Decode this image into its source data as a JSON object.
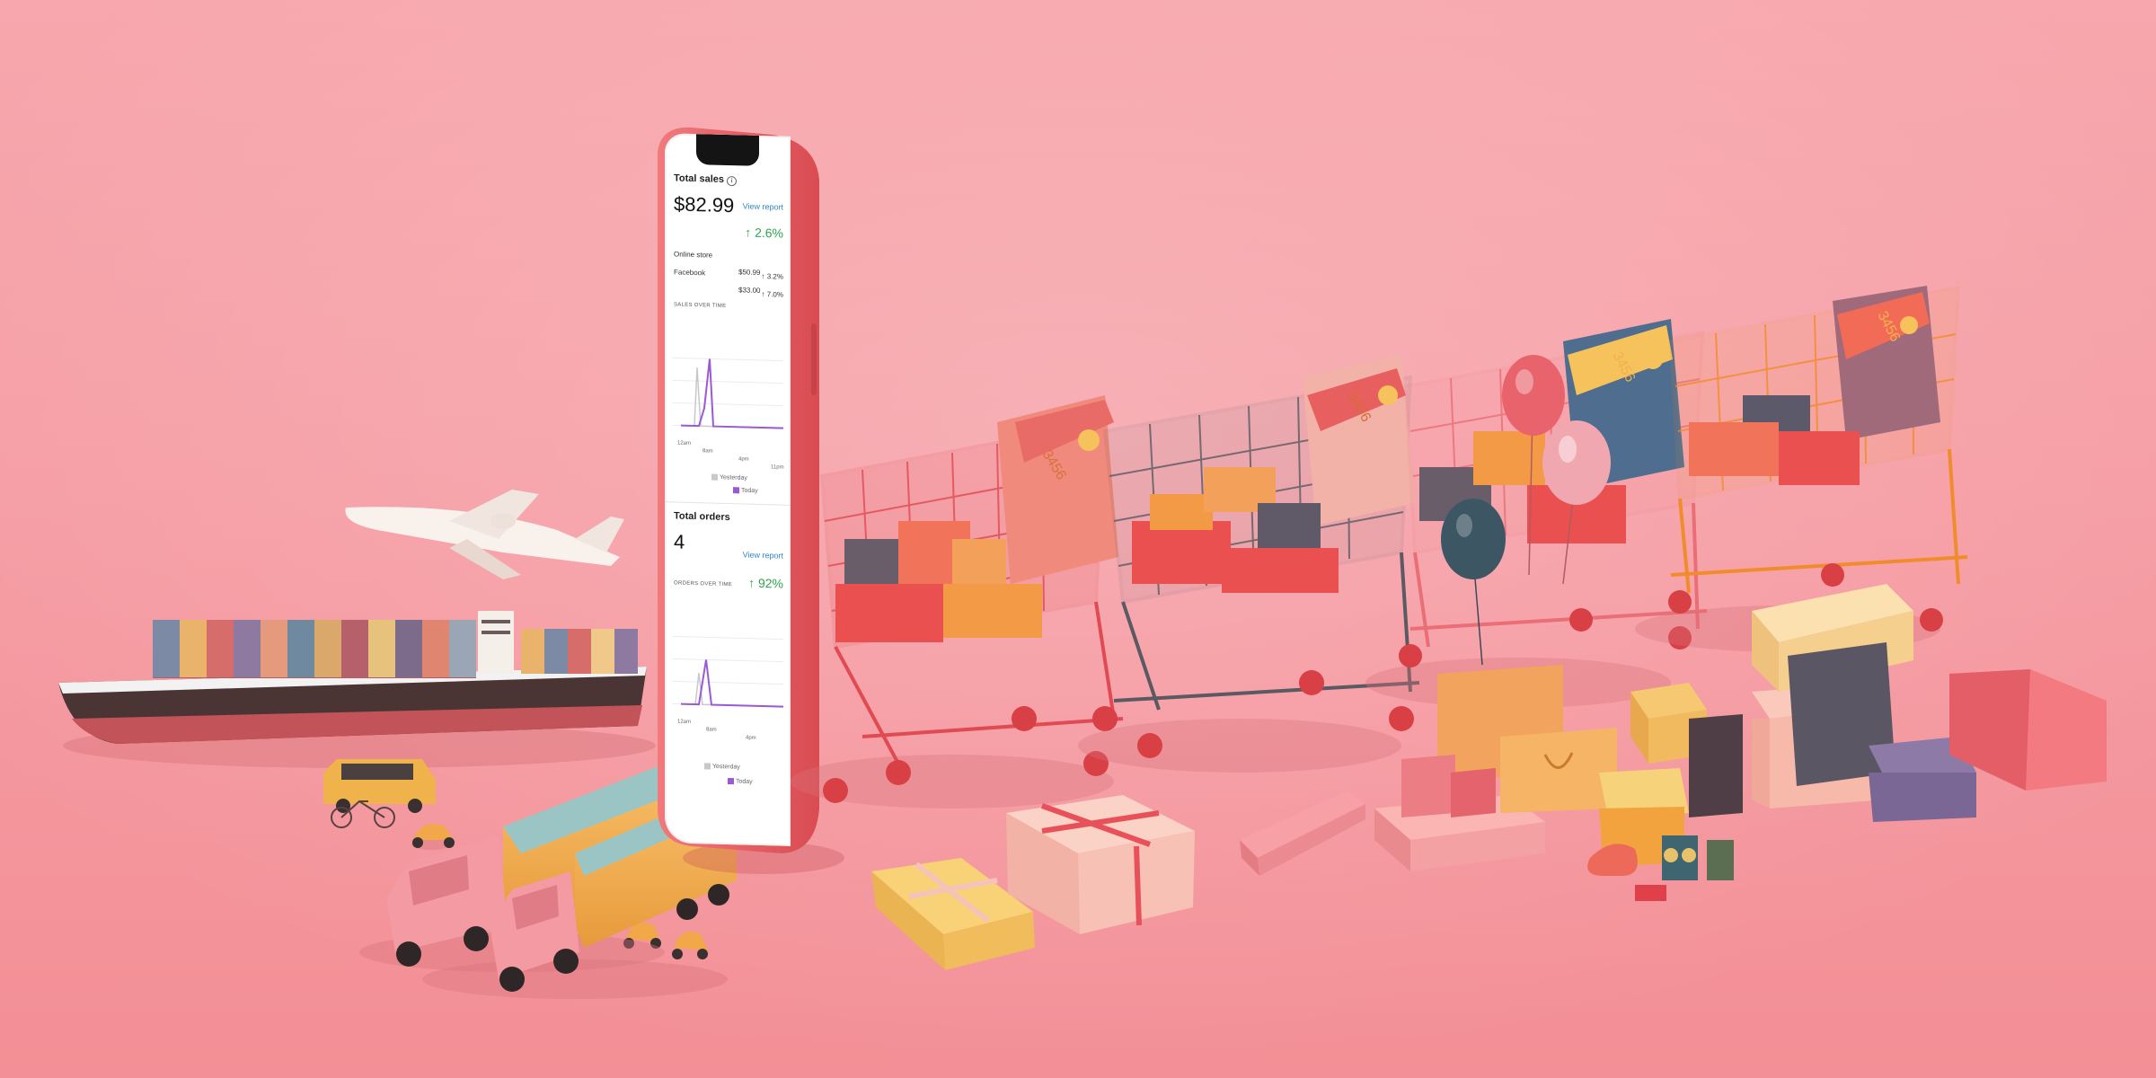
{
  "phone_app": {
    "total_sales_title": "Total sales",
    "total_sales_amount": "$82.99",
    "view_report_link": "View report",
    "sales_change": "↑ 2.6%",
    "online_store_label": "Online store",
    "facebook_label": "Facebook",
    "facebook_value_1": "$50.99",
    "facebook_pct_1": "↑ 3.2%",
    "facebook_value_2": "$33.00",
    "facebook_pct_2": "↑ 7.0%",
    "sales_over_time_label": "SALES OVER TIME",
    "chart_ticks": [
      "12am",
      "8am",
      "4pm",
      "11pm"
    ],
    "legend_yesterday": "Yesterday",
    "legend_today": "Today",
    "total_orders_title": "Total orders",
    "total_orders_value": "4",
    "orders_change": "↑ 92%",
    "orders_over_time_label": "ORDERS OVER TIME",
    "chart2_ticks": [
      "12am",
      "8am",
      "4pm"
    ],
    "legend2_yesterday": "Yesterday",
    "legend2_today": "Today"
  },
  "card_numbers": [
    "3456",
    "3456",
    "3456",
    "3456"
  ],
  "colors": {
    "background": "#f6a3a8",
    "phone_body": "#ea6a6e",
    "accent_purple": "#9b59d6",
    "accent_green": "#2ea44f",
    "link_blue": "#2f86c9"
  }
}
